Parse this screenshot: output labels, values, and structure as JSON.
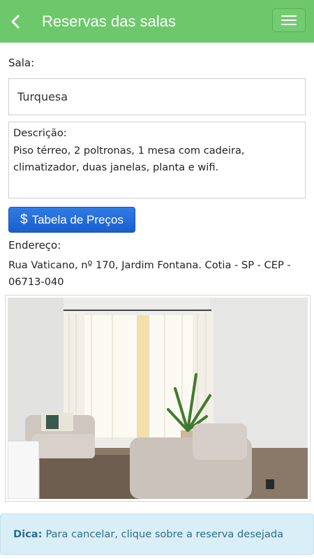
{
  "header": {
    "title": "Reservas das salas",
    "back_icon": "chevron-left-icon",
    "menu_icon": "hamburger-menu-icon",
    "background_color": "#6cc86a"
  },
  "form": {
    "sala_label": "Sala:",
    "sala_value": "Turquesa",
    "descricao_label": "Descrição:",
    "descricao_value": "Piso térreo, 2 poltronas, 1 mesa com cadeira, climatizador, duas janelas, planta e wifi.",
    "price_button_icon": "$",
    "price_button_label": "Tabela de Preços",
    "endereco_label": "Endereço:",
    "endereco_value": "Rua Vaticano, nº 170, Jardim Fontana. Cotia - SP - CEP - 06713-040"
  },
  "tip": {
    "title": "Dica:",
    "text": "Para cancelar, clique sobre a reserva desejada"
  }
}
